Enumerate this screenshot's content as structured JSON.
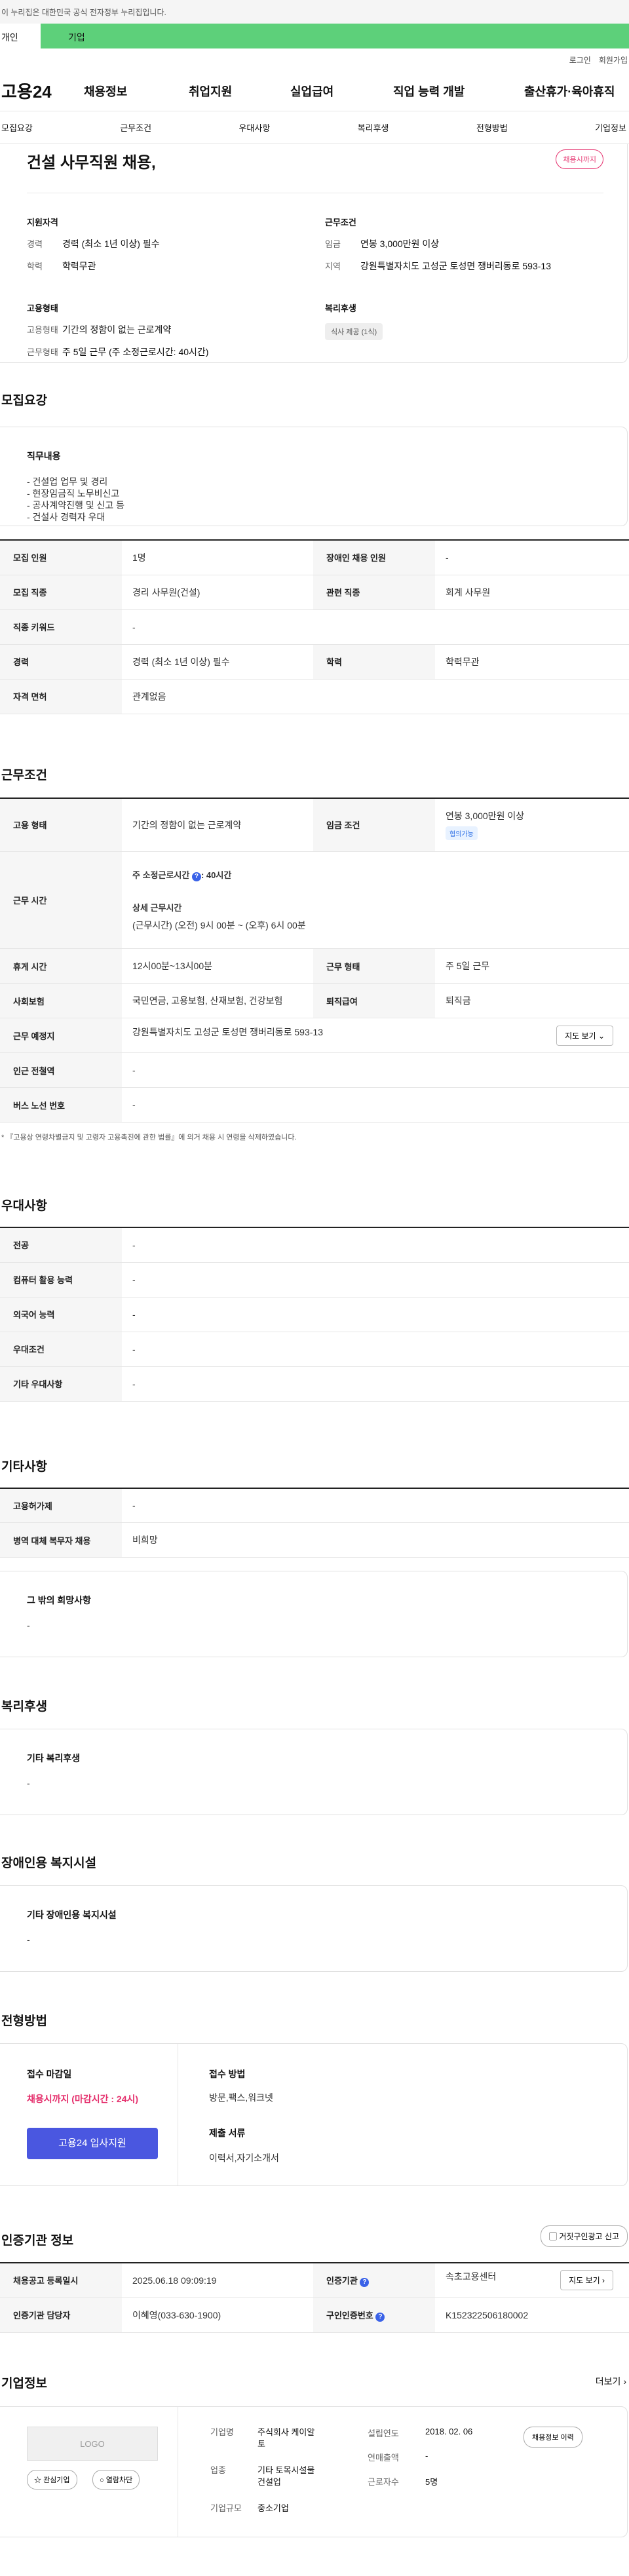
{
  "gov_notice": "이 누리집은 대한민국 공식 전자정부 누리집입니다.",
  "user_tabs": [
    "개인",
    "기업"
  ],
  "util": [
    "로그인",
    "회원가입"
  ],
  "logo": "고용24",
  "gnb": [
    "채용정보",
    "취업지원",
    "실업급여",
    "직업 능력 개발",
    "출산휴가·육아휴직"
  ],
  "subnav": [
    "모집요강",
    "근무조건",
    "우대사항",
    "복리후생",
    "전형방법",
    "기업정보"
  ],
  "job": {
    "title": "건설 사무직원 채용,",
    "status": "채용시까지"
  },
  "summary": {
    "qual_title": "지원자격",
    "qual": [
      {
        "k": "경력",
        "v": "경력 (최소 1년 이상) 필수"
      },
      {
        "k": "학력",
        "v": "학력무관"
      }
    ],
    "cond_title": "근무조건",
    "cond": [
      {
        "k": "임금",
        "v": "연봉 3,000만원 이상"
      },
      {
        "k": "지역",
        "v": "강원특별자치도 고성군 토성면 쟁버리동로 593-13"
      }
    ],
    "emp_title": "고용형태",
    "emp": [
      {
        "k": "고용형태",
        "v": "기간의 정함이 없는 근로계약"
      },
      {
        "k": "근무형태",
        "v": "주 5일 근무 (주 소정근로시간: 40시간)"
      }
    ],
    "welfare_title": "복리후생",
    "welfare_chip": "식사 제공 (1식)"
  },
  "recruit": {
    "title": "모집요강",
    "duty_title": "직무내용",
    "duties": [
      "- 건설업 업무 및 경리",
      "- 현장임금직 노무비신고",
      "- 공사계약진행 및 신고 등",
      "- 건설사 경력자 우대"
    ],
    "rows": [
      [
        "모집 인원",
        "1명",
        "장애인 채용 인원",
        "-"
      ],
      [
        "모집 직종",
        "경리 사무원(건설)",
        "관련 직종",
        "회계 사무원"
      ],
      [
        "직종 키워드",
        "-"
      ],
      [
        "경력",
        "경력 (최소 1년 이상) 필수",
        "학력",
        "학력무관"
      ],
      [
        "자격 면허",
        "관계없음"
      ]
    ]
  },
  "work": {
    "title": "근무조건",
    "emp_label": "고용 형태",
    "emp_value": "기간의 정함이 없는 근로계약",
    "wage_label": "임금 조건",
    "wage_value": "연봉 3,000만원 이상",
    "wage_tag": "협의가능",
    "hours_label": "근무 시간",
    "hours_main": "주 소정근로시간",
    "hours_value": ": 40시간",
    "hours_detail_title": "상세 근무시간",
    "hours_detail": "(근무시간) (오전) 9시 00분 ~ (오후) 6시 00분",
    "rows1": [
      [
        "휴게 시간",
        "12시00분~13시00분",
        "근무 형태",
        "주 5일 근무"
      ],
      [
        "사회보험",
        "국민연금, 고용보험, 산재보험, 건강보험",
        "퇴직급여",
        "퇴직금"
      ]
    ],
    "place_label": "근무 예정지",
    "place_value": "강원특별자치도 고성군 토성면 쟁버리동로 593-13",
    "map_btn": "지도 보기",
    "rows2": [
      [
        "인근 전철역",
        "-"
      ],
      [
        "버스 노선 번호",
        "-"
      ]
    ],
    "note": "* 『고용상 연령차별금지 및 고령자 고용촉진에 관한 법률』에 의거 채용 시 연령을 삭제하였습니다."
  },
  "pref": {
    "title": "우대사항",
    "rows": [
      [
        "전공",
        "-"
      ],
      [
        "컴퓨터 활용 능력",
        "-"
      ],
      [
        "외국어 능력",
        "-"
      ],
      [
        "우대조건",
        "-"
      ],
      [
        "기타 우대사항",
        "-"
      ]
    ]
  },
  "etc": {
    "title": "기타사항",
    "rows": [
      [
        "고용허가제",
        "-"
      ],
      [
        "병역 대체 복무자 채용",
        "비희망"
      ]
    ],
    "box_title": "그 밖의 희망사항",
    "box_value": "-"
  },
  "welfare": {
    "title": "복리후생",
    "box_title": "기타 복리후생",
    "box_value": "-"
  },
  "disab": {
    "title": "장애인용 복지시설",
    "box_title": "기타 장애인용 복지시설",
    "box_value": "-"
  },
  "process": {
    "title": "전형방법",
    "deadline_title": "접수 마감일",
    "deadline_value": "채용시까지 (마감시간 : 24시)",
    "apply_btn": "고용24 입사지원",
    "method_title": "접수 방법",
    "method_value": "방문,팩스,워크넷",
    "docs_title": "제출 서류",
    "docs_value": "이력서,자기소개서"
  },
  "agency": {
    "title": "인증기관 정보",
    "report_btn": "거짓구인광고 신고",
    "rows": [
      [
        "채용공고 등록일시",
        "2025.06.18 09:09:19",
        "인증기관",
        "속초고용센터"
      ],
      [
        "인증기관 담당자",
        "이혜영(033-630-1900)",
        "구인인증번호",
        "K152322506180002"
      ]
    ],
    "map_btn": "지도 보기"
  },
  "company": {
    "title": "기업정보",
    "more": "더보기",
    "logo_text": "LOGO",
    "btn_fav": "관심기업",
    "btn_block": "열람차단",
    "btn_jobs": "채용정보 이력",
    "left": [
      [
        "기업명",
        "주식회사 케이알 토"
      ],
      [
        "업종",
        "기타 토목시설물 건설업"
      ],
      [
        "기업규모",
        "중소기업"
      ]
    ],
    "right": [
      [
        "설립연도",
        "2018. 02. 06"
      ],
      [
        "연매출액",
        "-"
      ],
      [
        "근로자수",
        "5명"
      ]
    ]
  }
}
